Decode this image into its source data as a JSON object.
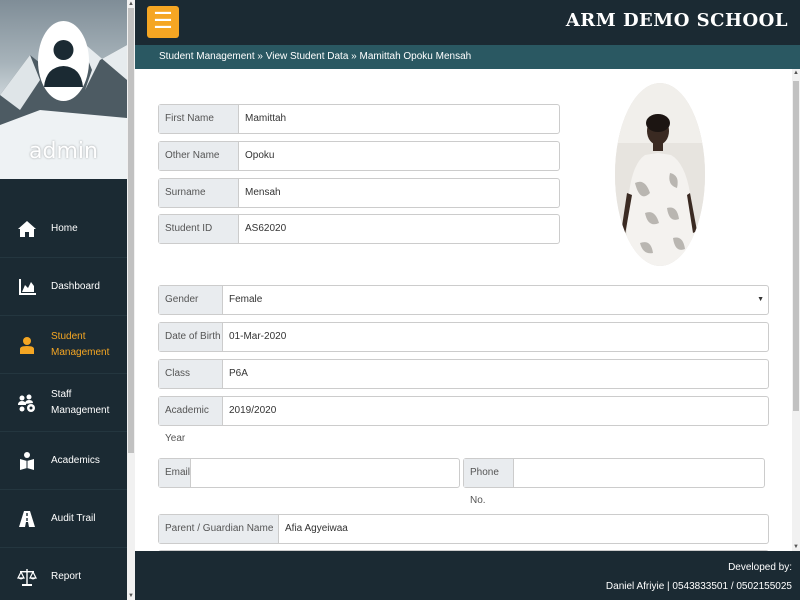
{
  "app": {
    "school_name": "ARM DEMO SCHOOL"
  },
  "user": {
    "name": "admin"
  },
  "breadcrumb": "Student Management » View Student Data » Mamittah Opoku Mensah",
  "nav": [
    {
      "label": "Home",
      "icon": "home-icon"
    },
    {
      "label": "Dashboard",
      "icon": "chart-icon"
    },
    {
      "label": "Student Management",
      "icon": "user-icon"
    },
    {
      "label": "Staff Management",
      "icon": "users-gear-icon"
    },
    {
      "label": "Academics",
      "icon": "book-user-icon"
    },
    {
      "label": "Audit Trail",
      "icon": "road-icon"
    },
    {
      "label": "Report",
      "icon": "scale-icon"
    }
  ],
  "active_nav": "Student Management",
  "student": {
    "first_name": {
      "label": "First Name",
      "value": "Mamittah"
    },
    "other_name": {
      "label": "Other Name",
      "value": "Opoku"
    },
    "surname": {
      "label": "Surname",
      "value": "Mensah"
    },
    "student_id": {
      "label": "Student ID",
      "value": "AS62020"
    },
    "gender": {
      "label": "Gender",
      "value": "Female"
    },
    "dob": {
      "label": "Date of Birth",
      "value": "01-Mar-2020"
    },
    "class": {
      "label": "Class",
      "value": "P6A"
    },
    "academic_year": {
      "label": "Academic Year",
      "value": "2019/2020"
    },
    "email": {
      "label": "Email",
      "value": ""
    },
    "phone": {
      "label": "Phone No.",
      "value": ""
    },
    "guardian": {
      "label": "Parent / Guardian Name",
      "value": "Afia Agyeiwaa"
    }
  },
  "footer": {
    "line1": "Developed by:",
    "line2": "Daniel Afriyie | 0543833501 / 0502155025"
  },
  "colors": {
    "accent": "#f5a623",
    "sidebar": "#1b2a33",
    "breadcrumb": "#2a5862"
  }
}
